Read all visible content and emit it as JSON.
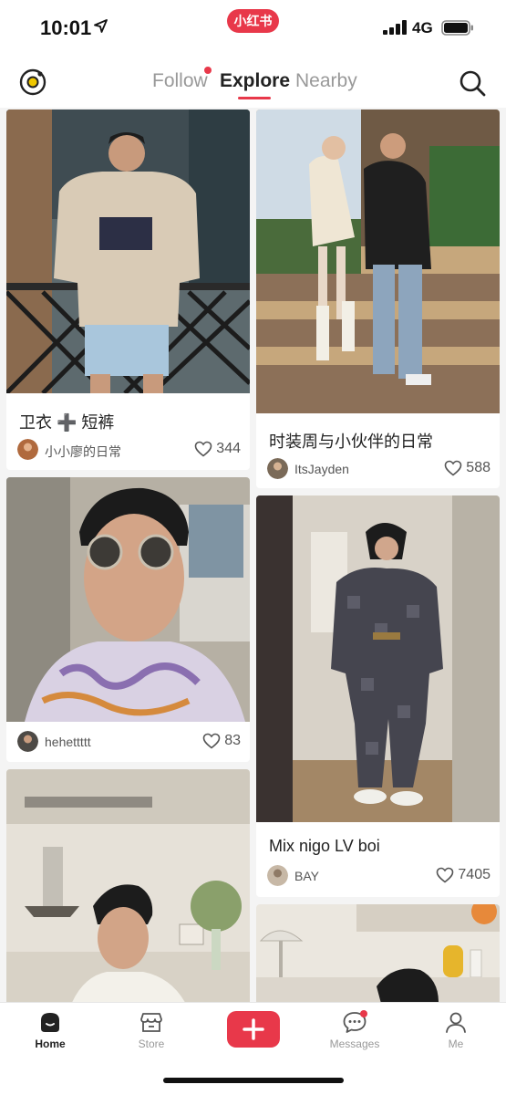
{
  "status_bar": {
    "time": "10:01",
    "network": "4G"
  },
  "app_badge": "小红书",
  "header": {
    "tabs": [
      {
        "label": "Follow",
        "active": false,
        "has_dot": true
      },
      {
        "label": "Explore",
        "active": true
      },
      {
        "label": "Nearby",
        "active": false
      }
    ]
  },
  "feed": {
    "cards": [
      {
        "title": "卫衣 ➕ 短裤",
        "author": "小小廖的日常",
        "likes": "344",
        "image": "man in beige hoodie and shorts"
      },
      {
        "title": "时装周与小伙伴的日常",
        "author": "ItsJayden",
        "likes": "588",
        "image": "couple on stone steps"
      },
      {
        "title": "",
        "author": "hehettttt",
        "likes": "83",
        "image": "selfie with sunglasses"
      },
      {
        "title": "Mix nigo LV boi",
        "author": "BAY",
        "likes": "7405",
        "image": "mirror selfie in patterned suit"
      },
      {
        "title": "",
        "author": "",
        "likes": "",
        "image": "man in kitchen"
      },
      {
        "title": "",
        "author": "",
        "likes": "",
        "image": "room with lamp"
      }
    ]
  },
  "bottom_nav": {
    "items": [
      {
        "label": "Home",
        "active": true
      },
      {
        "label": "Store",
        "active": false
      },
      {
        "label": "",
        "type": "add"
      },
      {
        "label": "Messages",
        "active": false,
        "has_dot": true
      },
      {
        "label": "Me",
        "active": false
      }
    ]
  },
  "colors": {
    "accent": "#e8384a",
    "text": "#222222",
    "muted": "#999999",
    "background": "#f4f4f4"
  }
}
